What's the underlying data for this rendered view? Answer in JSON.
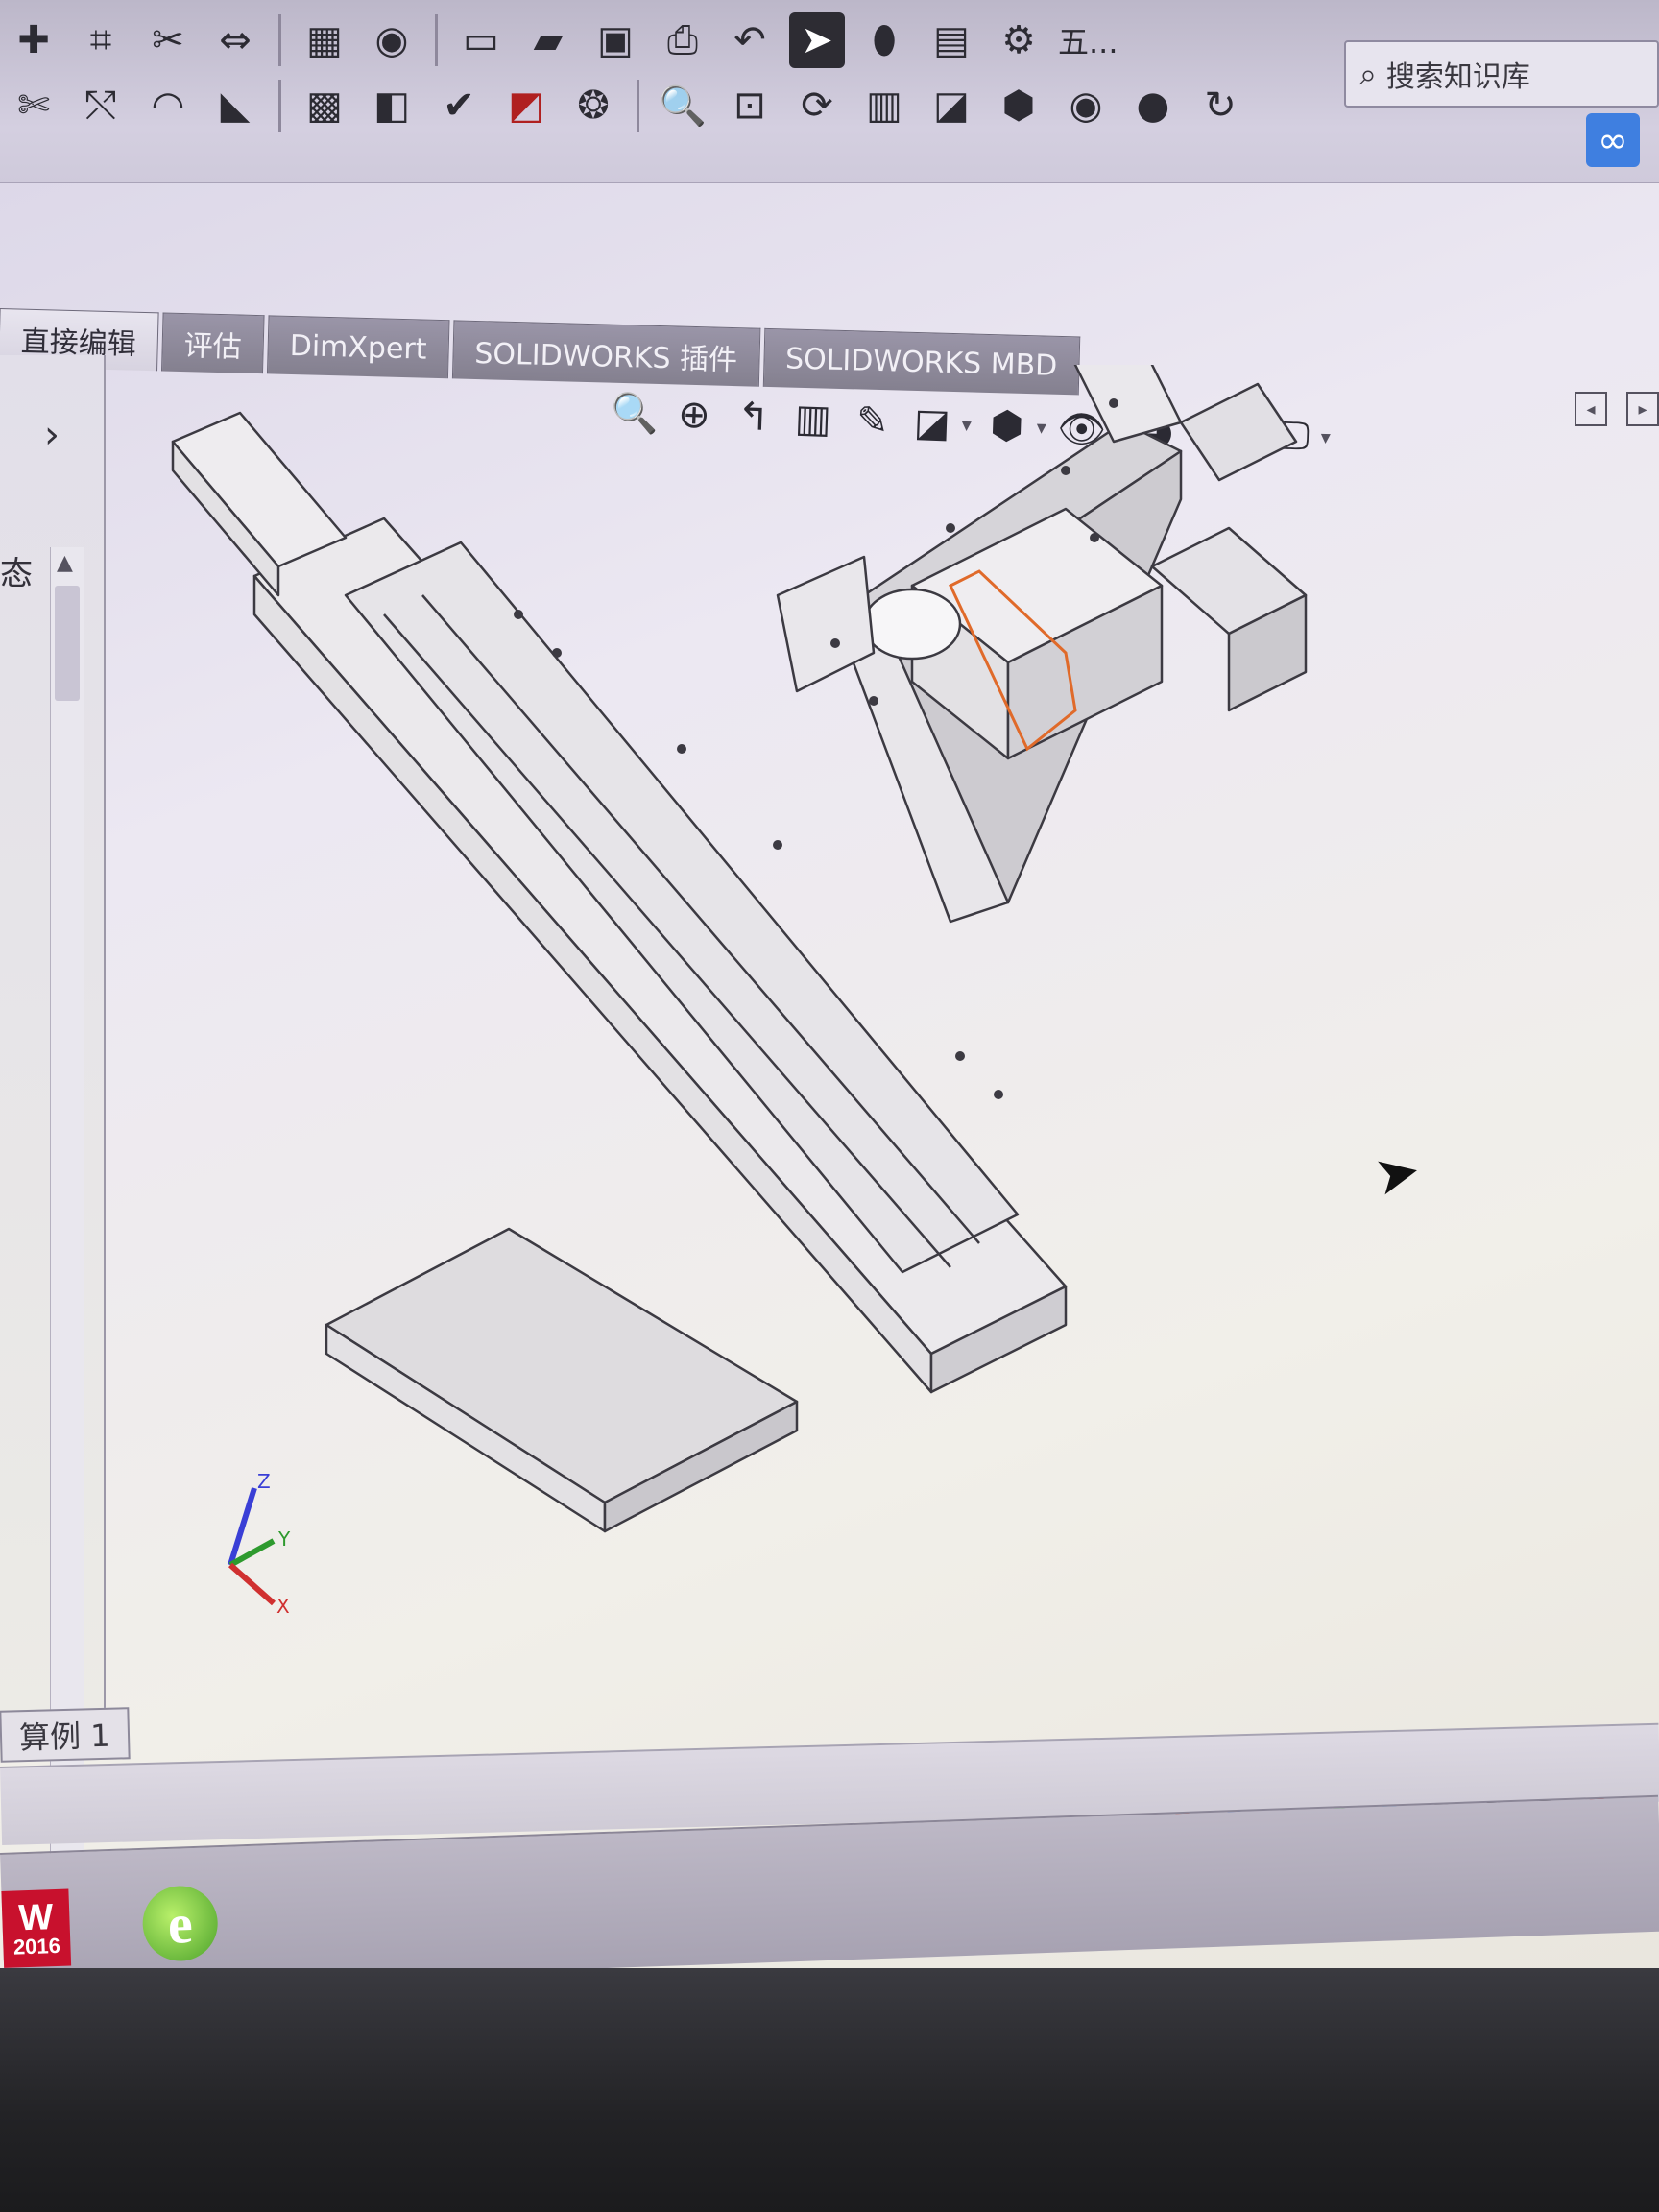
{
  "toolbar": {
    "search_placeholder": "搜索知识库",
    "truncated_label": "五...",
    "icons_row1": [
      "sketch-icon",
      "smart-dimension-icon",
      "trim-icon",
      "mirror-icon",
      "extrude-icon",
      "revolve-icon",
      "check-icon",
      "cut-icon",
      "pattern-icon"
    ],
    "icons_row2": [
      "zoom-fit-icon",
      "zoom-area-icon",
      "rotate-icon",
      "section-view-icon",
      "view-orientation-icon",
      "display-style-icon",
      "hide-show-icon",
      "appearance-icon",
      "scene-icon"
    ]
  },
  "tabs": [
    {
      "label": "直接编辑",
      "active": true
    },
    {
      "label": "评估",
      "active": false
    },
    {
      "label": "DimXpert",
      "active": false
    },
    {
      "label": "SOLIDWORKS 插件",
      "active": false
    },
    {
      "label": "SOLIDWORKS MBD",
      "active": false
    }
  ],
  "left_panel": {
    "state_label": "态"
  },
  "graphics": {
    "triad_labels": {
      "x": "X",
      "y": "Y",
      "z": "Z"
    }
  },
  "config_tab": {
    "label": "算例 1"
  },
  "taskbar": {
    "solidworks_label": "W",
    "solidworks_year": "2016"
  },
  "colors": {
    "accent": "#3f7fe0",
    "solidworks_red": "#c8112d",
    "selection_orange": "#e06a2a"
  }
}
